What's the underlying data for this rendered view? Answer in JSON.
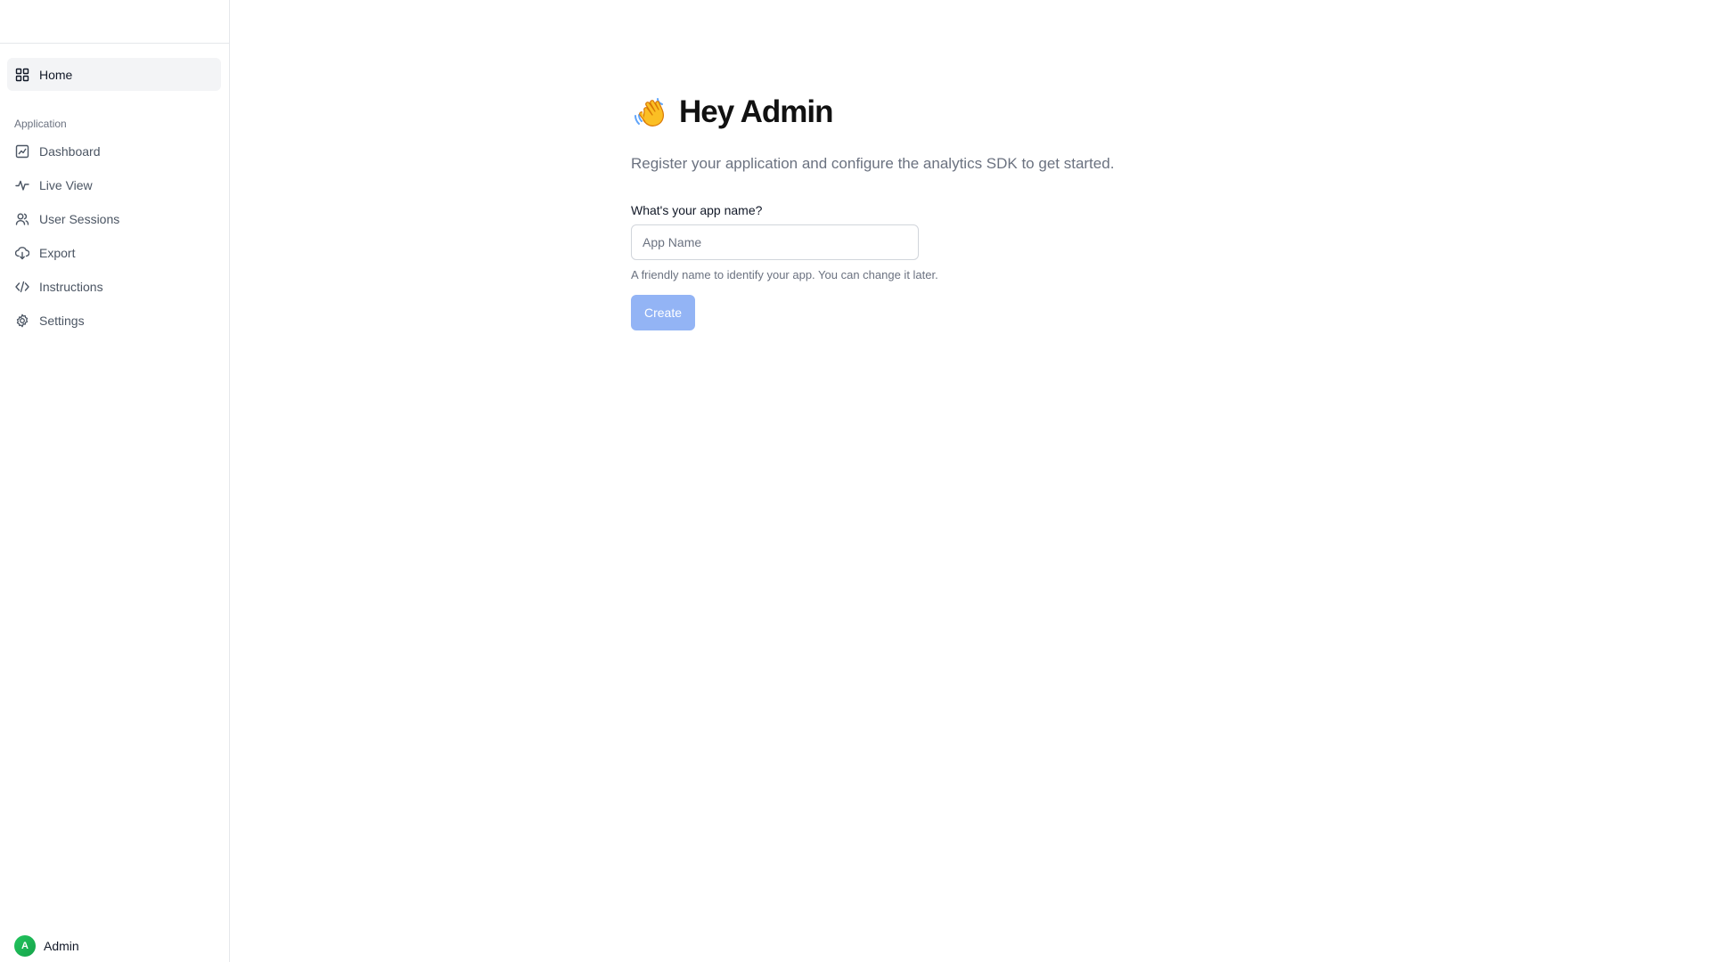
{
  "sidebar": {
    "home_label": "Home",
    "section_label": "Application",
    "items": [
      {
        "label": "Dashboard",
        "icon": "chart-icon"
      },
      {
        "label": "Live View",
        "icon": "activity-icon"
      },
      {
        "label": "User Sessions",
        "icon": "users-icon"
      },
      {
        "label": "Export",
        "icon": "cloud-download-icon"
      },
      {
        "label": "Instructions",
        "icon": "code-icon"
      },
      {
        "label": "Settings",
        "icon": "gear-icon"
      }
    ],
    "user": {
      "initial": "A",
      "name": "Admin"
    }
  },
  "main": {
    "greeting": "Hey Admin",
    "subtitle": "Register your application and configure the analytics SDK to get started.",
    "form": {
      "label": "What's your app name?",
      "placeholder": "App Name",
      "value": "",
      "helper": "A friendly name to identify your app. You can change it later.",
      "submit_label": "Create"
    }
  },
  "colors": {
    "active_nav_bg": "#f3f4f6",
    "button_disabled": "#93b4f5",
    "avatar": "#22c55e"
  }
}
